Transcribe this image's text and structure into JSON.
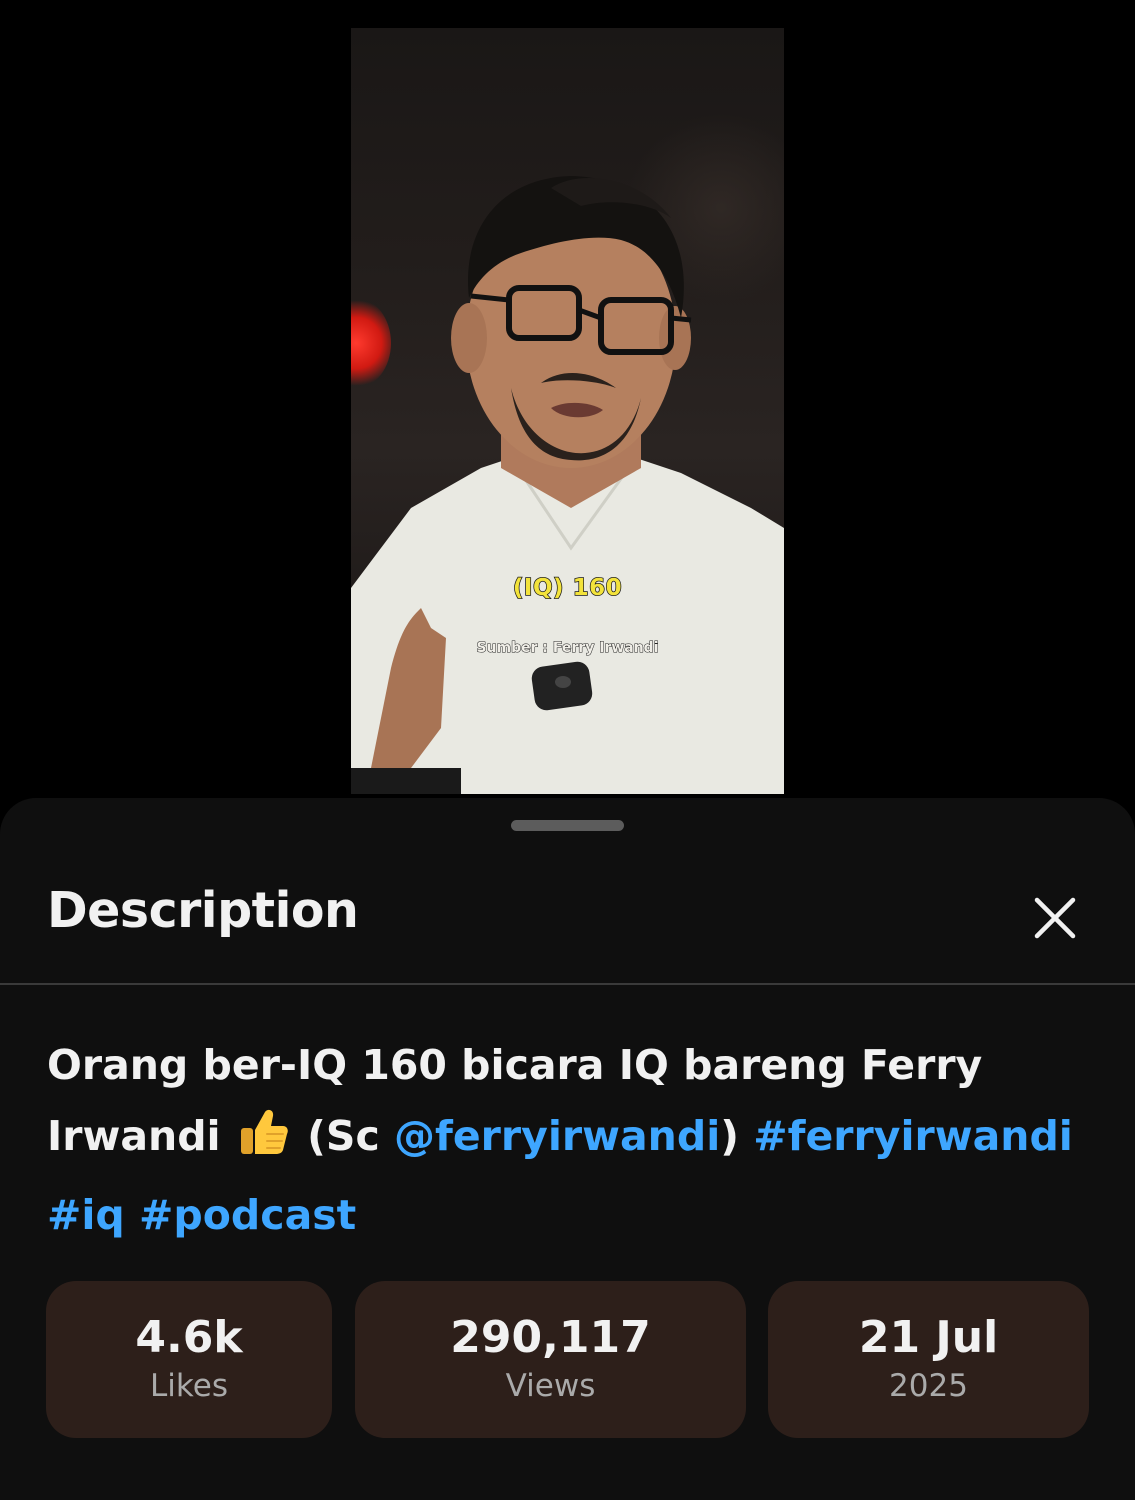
{
  "video": {
    "caption_main": "(IQ) 160",
    "caption_source": "Sumber : Ferry Irwandi"
  },
  "description_panel": {
    "title": "Description",
    "close_icon": "close-icon",
    "description": {
      "text_part1": "Orang ber-IQ 160 bicara IQ bareng Ferry Irwandi",
      "emoji": "thumbs-up-emoji",
      "text_part2": "(Sc",
      "mention": "@ferryirwandi",
      "text_part3": ")",
      "hashtags": [
        "#ferryirwandi",
        "#iq",
        "#podcast"
      ]
    },
    "stats": {
      "likes": {
        "value": "4.6k",
        "label": "Likes"
      },
      "views": {
        "value": "290,117",
        "label": "Views"
      },
      "date": {
        "value": "21 Jul",
        "label": "2025"
      }
    }
  },
  "colors": {
    "background": "#000000",
    "sheet": "#0f0f0f",
    "stat_card": "#2d1f1a",
    "link": "#3ea6ff",
    "caption_yellow": "#f3e33b"
  }
}
